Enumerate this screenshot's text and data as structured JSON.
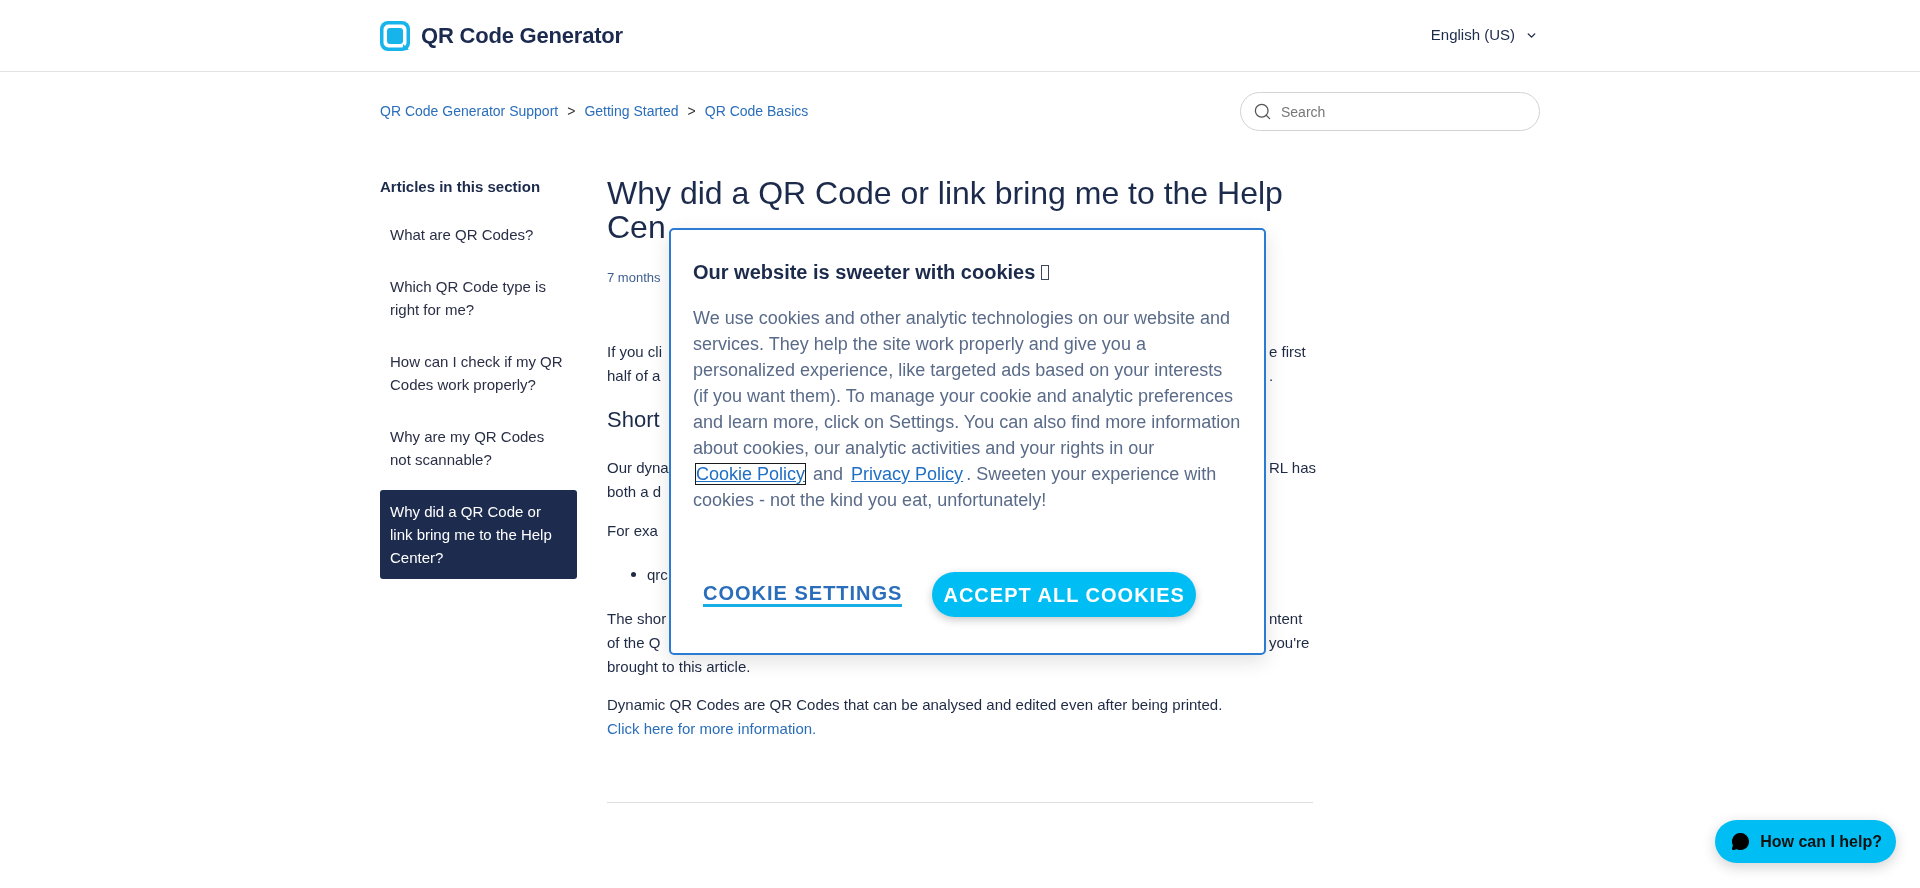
{
  "header": {
    "logo": "QR Code Generator",
    "language": "English (US)"
  },
  "breadcrumb": {
    "items": [
      "QR Code Generator Support",
      "Getting Started",
      "QR Code Basics"
    ],
    "separators": [
      ">",
      ">"
    ]
  },
  "search": {
    "placeholder": "Search"
  },
  "sidebar": {
    "title": "Articles in this section",
    "items": [
      {
        "label": "What are QR Codes?",
        "selected": false
      },
      {
        "label": "Which QR Code type is right for me?",
        "selected": false
      },
      {
        "label": "How can I check if my QR Codes work properly?",
        "selected": false
      },
      {
        "label": "Why are my QR Codes not scannable?",
        "selected": false
      },
      {
        "label": "Why did a QR Code or link bring me to the Help Center?",
        "selected": true
      }
    ]
  },
  "article": {
    "title_lines": [
      "Why did a QR Code or link bring me to the Help",
      "Cen"
    ],
    "meta": "7 months",
    "blocks": [
      {
        "kind": "paragraph",
        "lines": [
          {
            "left": "If you cli",
            "right": "e first"
          },
          {
            "left": "half of a",
            "right": "."
          }
        ]
      },
      {
        "kind": "heading",
        "lines": [
          {
            "left": "Short"
          }
        ]
      },
      {
        "kind": "paragraph",
        "lines": [
          {
            "left": "Our dyna",
            "right": "RL has"
          },
          {
            "left": "both a d"
          }
        ]
      },
      {
        "kind": "paragraph",
        "lines": [
          {
            "left": "For exa"
          }
        ]
      },
      {
        "kind": "bullet",
        "lines": [
          {
            "left": "qrc"
          }
        ]
      },
      {
        "kind": "paragraph",
        "lines": [
          {
            "left": "The shor",
            "right": "ntent"
          },
          {
            "left": "of the Q",
            "right": "you're"
          },
          {
            "left": "brought to this article."
          }
        ]
      },
      {
        "kind": "linked_paragraph",
        "text": "Dynamic QR Codes are QR Codes that can be analysed and edited even after being printed.",
        "link": "Click here for more information."
      }
    ]
  },
  "cookie_banner": {
    "title": "Our website is sweeter with cookies",
    "body": [
      {
        "kind": "text",
        "text": "We use cookies and other analytic technologies on our website and services. They help the site work properly and give you a personalized experience, like targeted ads based on your interests (if you want them). To manage your cookie and analytic preferences and learn more, click on Settings. You can also find more information about cookies, our analytic activities and your rights in our "
      },
      {
        "kind": "link",
        "text": "Cookie Policy",
        "focused": true
      },
      {
        "kind": "text",
        "text": " and "
      },
      {
        "kind": "link",
        "text": "Privacy Policy",
        "focused": false
      },
      {
        "kind": "text",
        "text": ". Sweeten your experience with cookies - not the kind you eat, unfortunately!"
      }
    ],
    "buttons": [
      {
        "kind": "text_link",
        "label": "COOKIE SETTINGS"
      },
      {
        "kind": "primary",
        "label": "ACCEPT ALL COOKIES"
      }
    ]
  },
  "chat_button": {
    "label": "How can I help?"
  }
}
